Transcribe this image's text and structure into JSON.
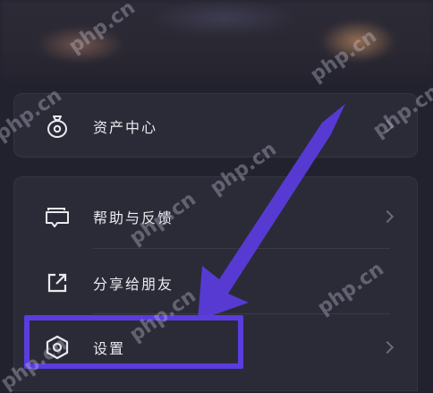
{
  "menu": {
    "assets": {
      "label": "资产中心",
      "icon": "wallet-icon"
    },
    "help": {
      "label": "帮助与反馈",
      "icon": "feedback-icon"
    },
    "share": {
      "label": "分享给朋友",
      "icon": "share-icon"
    },
    "settings": {
      "label": "设置",
      "icon": "settings-icon"
    }
  },
  "annotation": {
    "color": "#5b3cdf",
    "target": "settings"
  },
  "watermark": {
    "text": "php.cn"
  }
}
